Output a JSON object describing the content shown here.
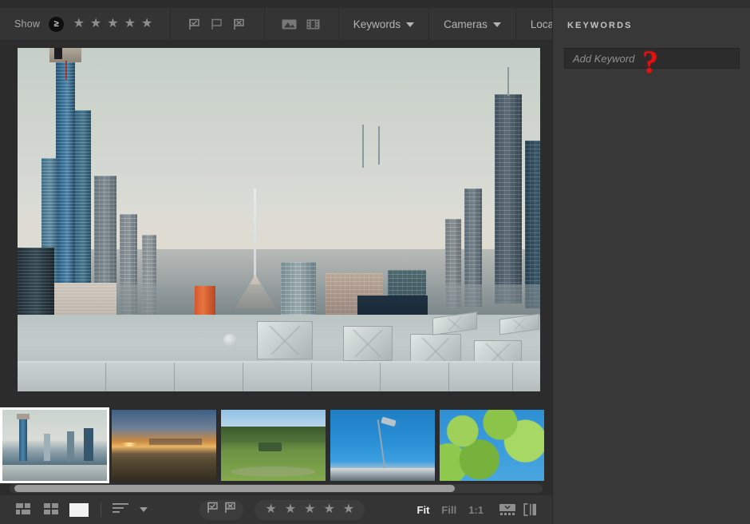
{
  "app": {
    "module": "library",
    "background": "#2c2c2c",
    "panel_background": "#383838"
  },
  "filter_bar": {
    "show_label": "Show",
    "rating_operator": "≥",
    "stars": [
      "★",
      "★",
      "★",
      "★",
      "★"
    ],
    "star_count": 5,
    "flags": [
      {
        "name": "flag-picked-icon",
        "label": "Flagged"
      },
      {
        "name": "flag-unflagged-icon",
        "label": "Unflagged"
      },
      {
        "name": "flag-rejected-icon",
        "label": "Rejected"
      }
    ],
    "media_types": [
      {
        "name": "photos-icon",
        "label": "Photos"
      },
      {
        "name": "videos-icon",
        "label": "Videos"
      }
    ],
    "dropdowns": [
      {
        "label": "Keywords"
      },
      {
        "label": "Cameras"
      },
      {
        "label": "Locations"
      }
    ]
  },
  "stage": {
    "selected_photo": "melbourne-skyline",
    "zoom_mode": "Fit"
  },
  "filmstrip": {
    "selected_index": 0,
    "thumbnails": [
      {
        "name": "thumb-melbourne-skyline",
        "selected": true
      },
      {
        "name": "thumb-sunset-cityscape",
        "selected": false
      },
      {
        "name": "thumb-park-bench",
        "selected": false
      },
      {
        "name": "thumb-street-lamp",
        "selected": false
      },
      {
        "name": "thumb-green-trees",
        "selected": false
      }
    ],
    "scroll_position": "left"
  },
  "bottom_bar": {
    "view_modes": [
      {
        "name": "grid-view-compact-icon",
        "active": false
      },
      {
        "name": "grid-view-icon",
        "active": false
      },
      {
        "name": "loupe-view-icon",
        "active": true
      }
    ],
    "sort_label": "sort-icon",
    "flag_filters": [
      {
        "name": "flag-picked-icon"
      },
      {
        "name": "flag-rejected-icon"
      }
    ],
    "rating_stars": [
      "★",
      "★",
      "★",
      "★",
      "★"
    ],
    "zoom_levels": [
      {
        "label": "Fit",
        "active": true
      },
      {
        "label": "Fill",
        "active": false
      },
      {
        "label": "1:1",
        "active": false
      }
    ],
    "extra_icons": [
      {
        "name": "info-overlay-icon"
      },
      {
        "name": "compare-view-icon"
      }
    ]
  },
  "keywords_panel": {
    "title": "KEYWORDS",
    "add_keyword_placeholder": "Add Keyword",
    "add_keyword_value": "",
    "keywords": []
  },
  "annotation": {
    "marker": "?",
    "color": "#e81010"
  }
}
